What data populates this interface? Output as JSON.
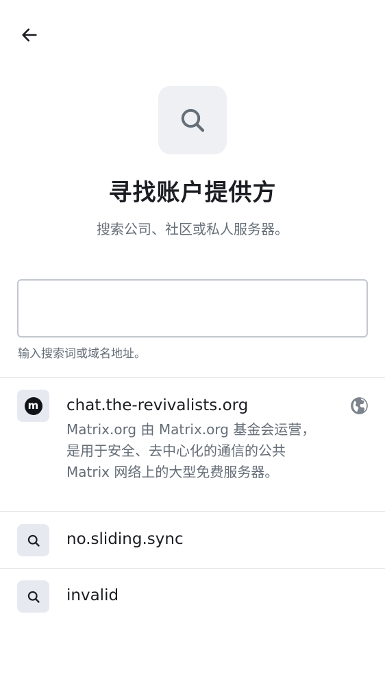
{
  "header": {
    "back_icon": "arrow-left-icon"
  },
  "hero": {
    "icon": "search-icon",
    "title": "寻找账户提供方",
    "subtitle": "搜索公司、社区或私人服务器。"
  },
  "search": {
    "value": "",
    "placeholder": "",
    "hint": "输入搜索词或域名地址。"
  },
  "results": [
    {
      "icon": "matrix-logo-icon",
      "icon_letter": "m",
      "name": "chat.the-revivalists.org",
      "description_lines": [
        "Matrix.org 由 Matrix.org 基金会运营，",
        "是用于安全、去中心化的通信的公共",
        "Matrix 网络上的大型免费服务器。"
      ],
      "trailing_icon": "globe-icon"
    },
    {
      "icon": "search-icon",
      "name": "no.sliding.sync"
    },
    {
      "icon": "search-icon",
      "name": "invalid"
    }
  ],
  "colors": {
    "primary_text": "#1b1d22",
    "secondary_text": "#656d77",
    "icon_tile_bg": "#e6e9f0",
    "hero_tile_bg": "#eef0f4",
    "divider": "#e5e7ea",
    "input_border": "#c2c6cd"
  }
}
